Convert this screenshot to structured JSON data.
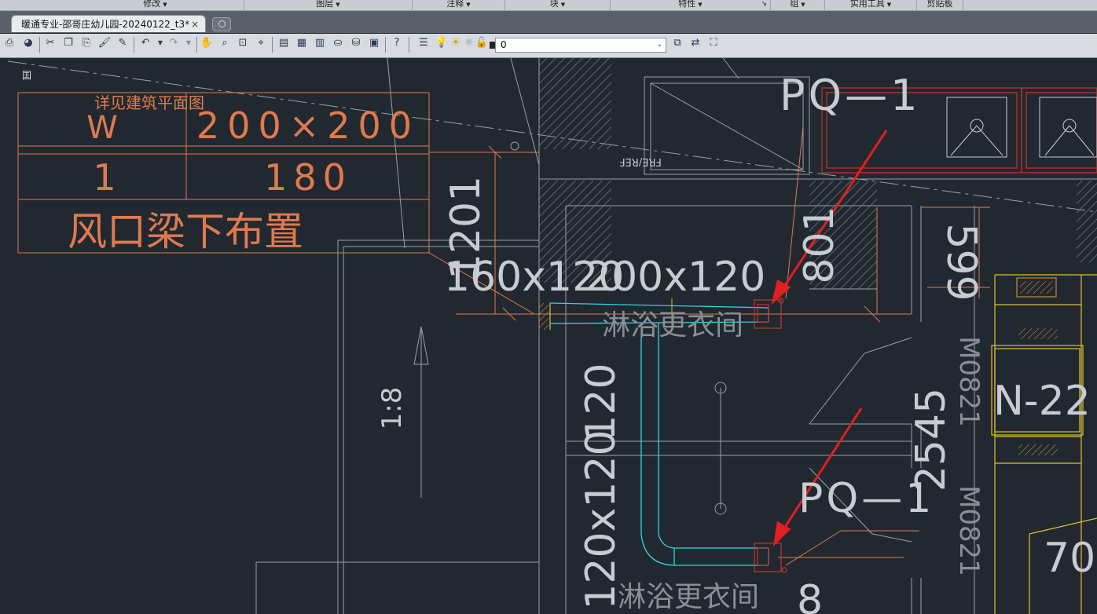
{
  "ribbon": {
    "panels": [
      "修改",
      "图层",
      "注释",
      "块",
      "特性",
      "组",
      "实用工具",
      "剪贴板"
    ],
    "corner_icon": "↘"
  },
  "tabs": {
    "active": "暖通专业-邵哥庄幼儿园-20240122_t3*",
    "close": "×"
  },
  "toolbar": {
    "layer_value": "0",
    "chevron": "⌄"
  },
  "drawing": {
    "corner_char": "囯",
    "table": {
      "header_note": "详见建筑平面图",
      "col1_header": "W",
      "col2_header": "200×200",
      "row_num": "1",
      "row_value": "180",
      "footer": "风口梁下布置"
    },
    "labels": {
      "dim_1201": "1201",
      "duct_160": "160x120",
      "duct_200": "200x120",
      "pq1_top": "PQ—1",
      "pq1_bottom": "PQ—1",
      "fre_ref": "FRE/REF",
      "shower_top": "淋浴更衣间",
      "shower_bottom": "淋浴更衣间",
      "slope": "1:8",
      "dim_120": "120",
      "duct_120x120": "120x120",
      "dim_801": "801",
      "dim_599": "599",
      "dim_2545": "2545",
      "door_m0821_a": "M0821",
      "door_m0821_b": "M0821",
      "n22": "N-22",
      "dim_70": "70",
      "dim_8": "8"
    }
  },
  "colors": {
    "background": "#212830",
    "orange": "#e07a4e",
    "white_line": "#c8ccd2",
    "cyan": "#35d4e0",
    "yellow": "#e0c030",
    "red": "#e02020",
    "hatch": "#7a7f86"
  }
}
